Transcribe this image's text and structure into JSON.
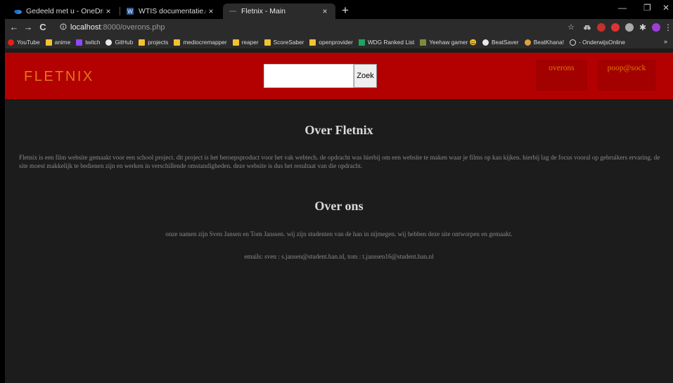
{
  "browser": {
    "tabs": [
      {
        "title": "Gedeeld met u - OneDrive",
        "close": "×"
      },
      {
        "title": "WTIS documentatie.docx",
        "close": "×"
      },
      {
        "title": "Fletnix - Main",
        "close": "×"
      }
    ],
    "new_tab": "+",
    "window_controls": {
      "minimize": "—",
      "maximize": "❐",
      "close": "✕"
    },
    "nav": {
      "back": "←",
      "forward": "→",
      "reload": "C"
    },
    "url": {
      "host": "localhost",
      "path": ":8000/overons.php"
    },
    "bookmarks": [
      {
        "label": "YouTube",
        "icon": "youtube-icon"
      },
      {
        "label": "anime",
        "icon": "folder-icon"
      },
      {
        "label": "twitch",
        "icon": "twitch-icon"
      },
      {
        "label": "GitHub",
        "icon": "github-icon"
      },
      {
        "label": "projects",
        "icon": "folder-icon"
      },
      {
        "label": "mediocremapper",
        "icon": "folder-icon"
      },
      {
        "label": "reaper",
        "icon": "folder-icon"
      },
      {
        "label": "ScoreSaber",
        "icon": "folder-icon"
      },
      {
        "label": "openprovider",
        "icon": "folder-icon"
      },
      {
        "label": "WDG Ranked List",
        "icon": "sheets-icon"
      },
      {
        "label": "Yeehaw gamer 😃",
        "icon": "image-icon"
      },
      {
        "label": "BeatSaver",
        "icon": "beatsaver-icon"
      },
      {
        "label": "BeatKhana!",
        "icon": "beatkhana-icon"
      },
      {
        "label": "- OnderwijsOnline",
        "icon": "circle-icon"
      }
    ],
    "bookmarks_more": "»"
  },
  "site": {
    "logo": "FLETNIX",
    "search": {
      "placeholder": "",
      "button_label": "Zoek"
    },
    "nav": [
      {
        "label": "overons"
      },
      {
        "label": "poop@sock"
      }
    ],
    "sections": [
      {
        "title": "Over Fletnix",
        "paragraphs": [
          "Fletnix is een film website gemaakt voor een school project. dit project is het beroepsproduct voor het vak webtech. de opdracht was hierbij om een website te maken waar je films op kan kijken. hierbij lag de focus vooral op gebruikers ervaring. de site moest makkelijk te bedienen zijn en werken in verschillende omstandigheden. deze website is dus het resultaat van die opdracht."
        ]
      },
      {
        "title": "Over ons",
        "paragraphs": [
          "onze namen zijn Sven Jansen en Tom Janssen. wij zijn studenten van de han in nijmegen. wij hebben deze site ontworpen en gemaakt.",
          "emails: sven : s.jansen@student.han.nl, tom : t.janssen16@student.han.nl"
        ]
      }
    ]
  },
  "colors": {
    "header_red": "#b30000",
    "logo_orange": "#e07818",
    "page_bg": "#1c1c1c"
  }
}
